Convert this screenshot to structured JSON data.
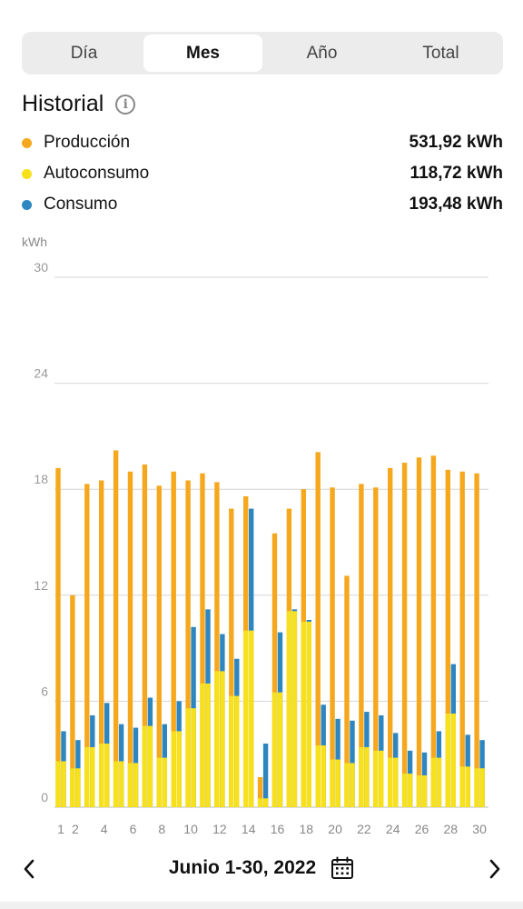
{
  "tabs": [
    {
      "label": "Día",
      "active": false
    },
    {
      "label": "Mes",
      "active": true
    },
    {
      "label": "Año",
      "active": false
    },
    {
      "label": "Total",
      "active": false
    }
  ],
  "historial": {
    "title": "Historial",
    "info_icon": "info-icon",
    "legend": [
      {
        "label": "Producción",
        "value": "531,92 kWh",
        "color": "#f5a81e"
      },
      {
        "label": "Autoconsumo",
        "value": "118,72 kWh",
        "color": "#f7e01c"
      },
      {
        "label": "Consumo",
        "value": "193,48 kWh",
        "color": "#2e86c1"
      }
    ]
  },
  "chart_data": {
    "type": "bar",
    "ylabel": "kWh",
    "ylim": [
      0,
      30
    ],
    "yticks": [
      0,
      6,
      12,
      18,
      24,
      30
    ],
    "xtick_labels": [
      "1",
      "2",
      "4",
      "6",
      "8",
      "10",
      "12",
      "14",
      "16",
      "18",
      "20",
      "22",
      "24",
      "26",
      "28",
      "30"
    ],
    "xtick_days": [
      1,
      2,
      4,
      6,
      8,
      10,
      12,
      14,
      16,
      18,
      20,
      22,
      24,
      26,
      28,
      30
    ],
    "days": [
      1,
      2,
      3,
      4,
      5,
      6,
      7,
      8,
      9,
      10,
      11,
      12,
      13,
      14,
      15,
      16,
      17,
      18,
      19,
      20,
      21,
      22,
      23,
      24,
      25,
      26,
      27,
      28,
      29,
      30
    ],
    "series": [
      {
        "name": "Producción",
        "color": "#f5a81e",
        "values": [
          19.2,
          12.0,
          18.3,
          18.5,
          20.2,
          19.0,
          19.4,
          18.2,
          19.0,
          18.5,
          18.9,
          18.4,
          16.9,
          17.6,
          1.7,
          15.5,
          16.9,
          18.0,
          20.1,
          18.1,
          13.1,
          18.3,
          18.1,
          19.2,
          19.5,
          19.8,
          19.9,
          19.1,
          19.0,
          18.9
        ]
      },
      {
        "name": "Autoconsumo",
        "color": "#f7e01c",
        "values": [
          2.6,
          2.2,
          3.4,
          3.6,
          2.6,
          2.5,
          4.6,
          2.8,
          4.3,
          5.6,
          7.0,
          7.7,
          6.3,
          10.0,
          0.5,
          6.5,
          11.1,
          10.5,
          3.5,
          2.7,
          2.5,
          3.4,
          3.2,
          2.8,
          1.9,
          1.8,
          2.8,
          5.3,
          2.3,
          2.2
        ]
      },
      {
        "name": "Consumo",
        "color": "#2e86c1",
        "values": [
          4.3,
          3.8,
          5.2,
          5.9,
          4.7,
          4.5,
          6.2,
          4.7,
          6.0,
          10.2,
          11.2,
          9.8,
          8.4,
          16.9,
          3.6,
          9.9,
          11.2,
          10.6,
          5.8,
          5.0,
          4.9,
          5.4,
          5.2,
          4.2,
          3.2,
          3.1,
          4.3,
          8.1,
          4.1,
          3.8
        ]
      }
    ]
  },
  "footer": {
    "prev_icon": "chevron-left-icon",
    "next_icon": "chevron-right-icon",
    "date_range": "Junio 1-30, 2022",
    "calendar_icon": "calendar-icon"
  }
}
